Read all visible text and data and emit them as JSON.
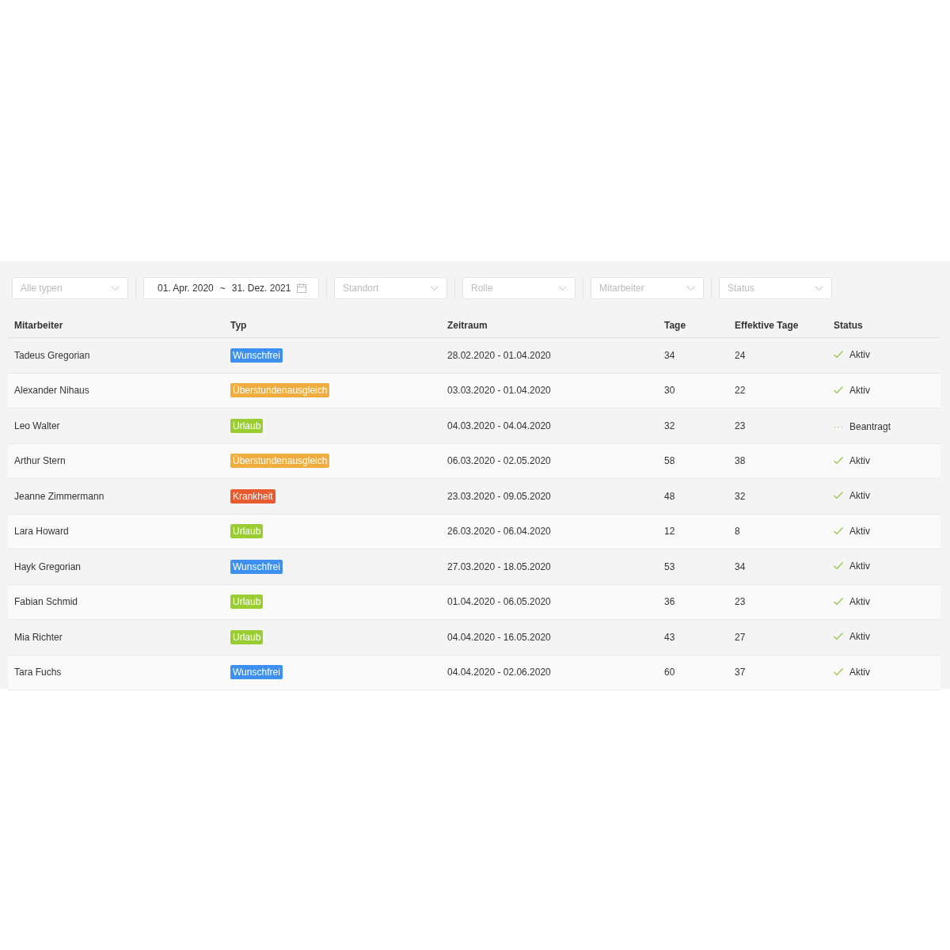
{
  "filters": [
    {
      "kind": "select",
      "placeholder": "Alle typen"
    },
    {
      "kind": "daterange",
      "from": "01. Apr. 2020",
      "separator": "~",
      "to": "31. Dez. 2021"
    },
    {
      "kind": "select",
      "placeholder": "Standort"
    },
    {
      "kind": "select",
      "placeholder": "Rolle"
    },
    {
      "kind": "select",
      "placeholder": "Mitarbeiter"
    },
    {
      "kind": "select",
      "placeholder": "Status"
    }
  ],
  "table": {
    "columns": [
      "Mitarbeiter",
      "Typ",
      "Zeitraum",
      "Tage",
      "Effektive Tage",
      "Status"
    ],
    "rows": [
      {
        "employee": "Tadeus Gregorian",
        "type": "Wunschfrei",
        "color": "#3d8ff0",
        "period": "28.02.2020 - 01.04.2020",
        "days": "34",
        "effective_days": "24",
        "status": "Aktiv",
        "kind": "active"
      },
      {
        "employee": "Alexander Nihaus",
        "type": "Überstundenausgleich",
        "color": "#f0ac3c",
        "period": "03.03.2020 - 01.04.2020",
        "days": "30",
        "effective_days": "22",
        "status": "Aktiv",
        "kind": "active"
      },
      {
        "employee": "Leo Walter",
        "type": "Urlaub",
        "color": "#9acd32",
        "period": "04.03.2020 - 04.04.2020",
        "days": "32",
        "effective_days": "23",
        "status": "Beantragt",
        "kind": "requested"
      },
      {
        "employee": "Arthur Stern",
        "type": "Überstundenausgleich",
        "color": "#f0ac3c",
        "period": "06.03.2020 - 02.05.2020",
        "days": "58",
        "effective_days": "38",
        "status": "Aktiv",
        "kind": "active"
      },
      {
        "employee": "Jeanne Zimmermann",
        "type": "Krankheit",
        "color": "#ea5a2f",
        "period": "23.03.2020 - 09.05.2020",
        "days": "48",
        "effective_days": "32",
        "status": "Aktiv",
        "kind": "active"
      },
      {
        "employee": "Lara Howard",
        "type": "Urlaub",
        "color": "#9acd32",
        "period": "26.03.2020 - 06.04.2020",
        "days": "12",
        "effective_days": "8",
        "status": "Aktiv",
        "kind": "active"
      },
      {
        "employee": "Hayk Gregorian",
        "type": "Wunschfrei",
        "color": "#3d8ff0",
        "period": "27.03.2020 - 18.05.2020",
        "days": "53",
        "effective_days": "34",
        "status": "Aktiv",
        "kind": "active"
      },
      {
        "employee": "Fabian Schmid",
        "type": "Urlaub",
        "color": "#9acd32",
        "period": "01.04.2020 - 06.05.2020",
        "days": "36",
        "effective_days": "23",
        "status": "Aktiv",
        "kind": "active"
      },
      {
        "employee": "Mia Richter",
        "type": "Urlaub",
        "color": "#9acd32",
        "period": "04.04.2020 - 16.05.2020",
        "days": "43",
        "effective_days": "27",
        "status": "Aktiv",
        "kind": "active"
      },
      {
        "employee": "Tara Fuchs",
        "type": "Wunschfrei",
        "color": "#3d8ff0",
        "period": "04.04.2020 - 02.06.2020",
        "days": "60",
        "effective_days": "37",
        "status": "Aktiv",
        "kind": "active"
      }
    ]
  }
}
